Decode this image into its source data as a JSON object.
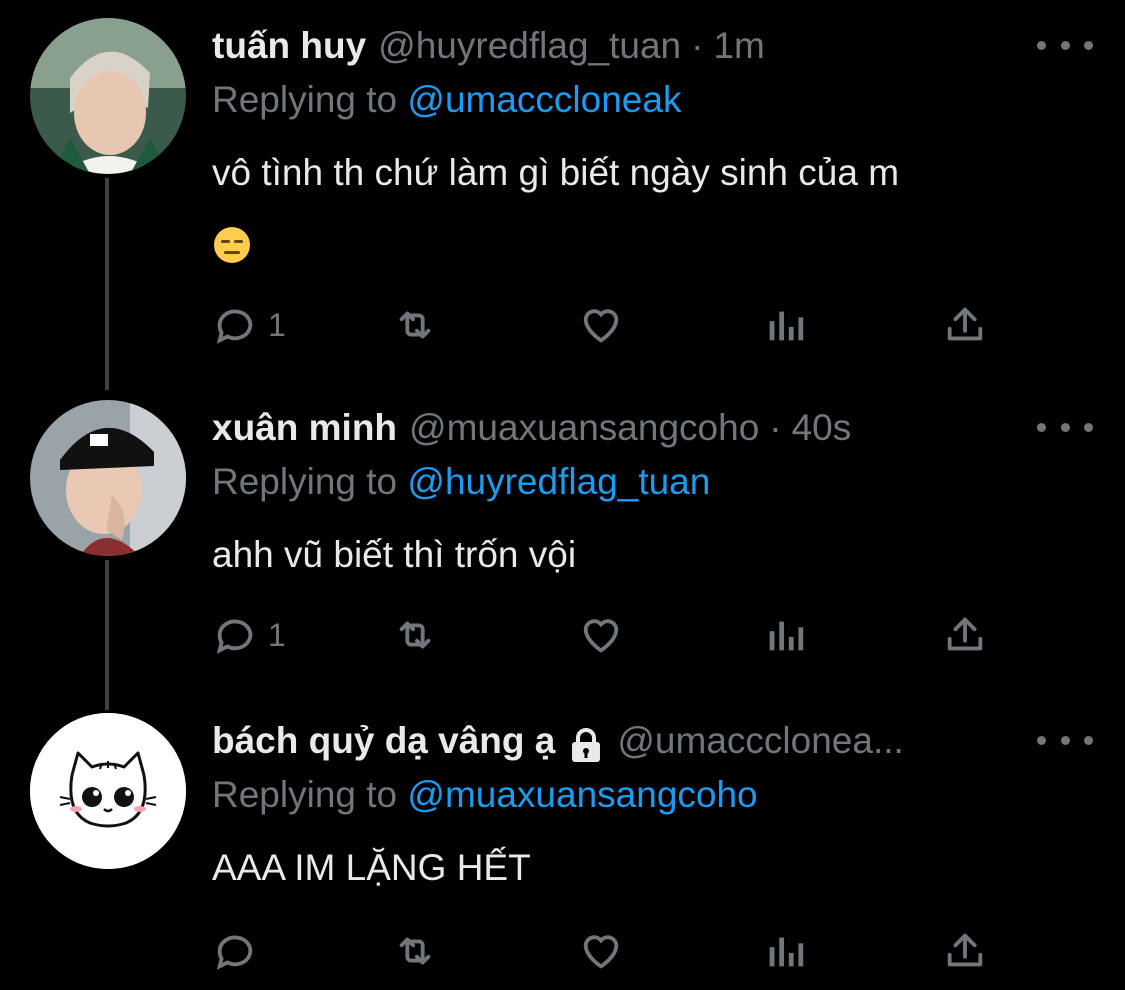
{
  "tweets": [
    {
      "name": "tuấn huy",
      "handle": "@huyredflag_tuan",
      "time": "1m",
      "replying_prefix": "Replying to",
      "replying_to": "@umacccloneаk",
      "text": "vô tình th chứ làm gì biết ngày sinh của m",
      "emoji": "expressionless-face",
      "reply_count": "1"
    },
    {
      "name": "xuân minh",
      "handle": "@muaxuansangcoho",
      "time": "40s",
      "replying_prefix": "Replying to",
      "replying_to": "@huyredflag_tuan",
      "text": "ahh vũ biết thì trốn vội",
      "reply_count": "1"
    },
    {
      "name": "bách quỷ dạ vâng ạ",
      "handle": "@umaccclonea...",
      "replying_prefix": "Replying to",
      "replying_to": "@muaxuansangcoho",
      "text": "AAA IM LẶNG HẾT",
      "reply_count": ""
    }
  ],
  "icons": {
    "reply": "speech-bubble-icon",
    "retweet": "retweet-icon",
    "like": "heart-icon",
    "views": "bar-chart-icon",
    "share": "share-upload-icon",
    "more": "more-dots-icon",
    "protected": "lock-icon"
  },
  "colors": {
    "background": "#000000",
    "text": "#e7e9ea",
    "muted": "#71767b",
    "link": "#1d9bf0",
    "thread_line": "#3e4144"
  }
}
